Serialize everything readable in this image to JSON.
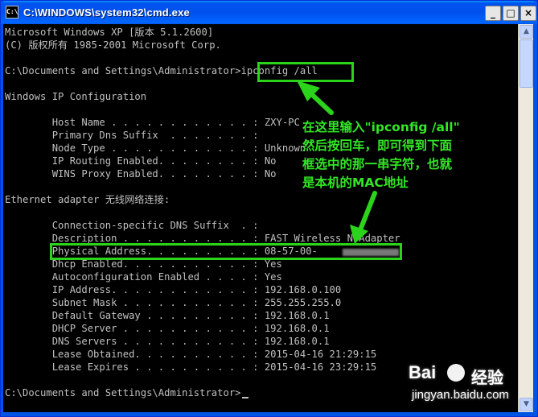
{
  "window": {
    "icon_text": "C:\\",
    "title": "C:\\WINDOWS\\system32\\cmd.exe",
    "buttons": {
      "minimize": "_",
      "maximize": "□",
      "close": "×"
    }
  },
  "console": {
    "lines": [
      "Microsoft Windows XP [版本 5.1.2600]",
      "(C) 版权所有 1985-2001 Microsoft Corp.",
      "",
      "C:\\Documents and Settings\\Administrator>ipconfig /all",
      "",
      "Windows IP Configuration",
      "",
      "        Host Name . . . . . . . . . . . . : ZXY-PC",
      "        Primary Dns Suffix  . . . . . . . :",
      "        Node Type . . . . . . . . . . . . : Unknown",
      "        IP Routing Enabled. . . . . . . . : No",
      "        WINS Proxy Enabled. . . . . . . . : No",
      "",
      "Ethernet adapter 无线网络连接:",
      "",
      "        Connection-specific DNS Suffix  . :",
      "        Description . . . . . . . . . . . : FAST Wireless N Adapter",
      "        Physical Address. . . . . . . . . : 08-57-00-",
      "        Dhcp Enabled. . . . . . . . . . . : Yes",
      "        Autoconfiguration Enabled . . . . : Yes",
      "        IP Address. . . . . . . . . . . . : 192.168.0.100",
      "        Subnet Mask . . . . . . . . . . . : 255.255.255.0",
      "        Default Gateway . . . . . . . . . : 192.168.0.1",
      "        DHCP Server . . . . . . . . . . . : 192.168.0.1",
      "        DNS Servers . . . . . . . . . . . : 192.168.0.1",
      "        Lease Obtained. . . . . . . . . . : 2015-04-16 21:29:15",
      "        Lease Expires . . . . . . . . . . : 2015-04-16 23:29:15",
      "",
      "C:\\Documents and Settings\\Administrator>"
    ]
  },
  "annotation": {
    "text": "在这里输入\"ipconfig /all\"\n然后按回车，即可得到下面\n框选中的那一串字符，也就\n是本机的MAC地址"
  },
  "scrollbar": {
    "up_arrow": "▲",
    "down_arrow": "▼"
  },
  "watermark": {
    "logo": "Bai",
    "sub": "经验",
    "url": "jingyan.baidu.com"
  }
}
